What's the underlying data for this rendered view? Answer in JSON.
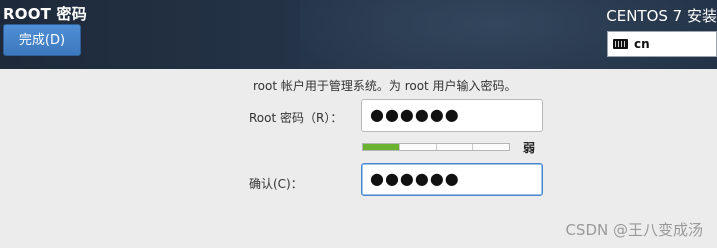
{
  "header": {
    "title": "ROOT 密码",
    "done_label": "完成(D)",
    "product": "CENTOS 7 安装",
    "keyboard": {
      "icon": "keyboard-icon",
      "layout": "cn"
    }
  },
  "form": {
    "description": "root 帐户用于管理系统。为 root 用户输入密码。",
    "root_label": "Root 密码（R）：",
    "root_value": "●●●●●●",
    "strength": {
      "level": 0.25,
      "segments": 4,
      "label": "弱",
      "color": "#6ab22f"
    },
    "confirm_label": "确认(C)：",
    "confirm_value": "●●●●●●"
  },
  "watermark": "CSDN @王八变成汤"
}
